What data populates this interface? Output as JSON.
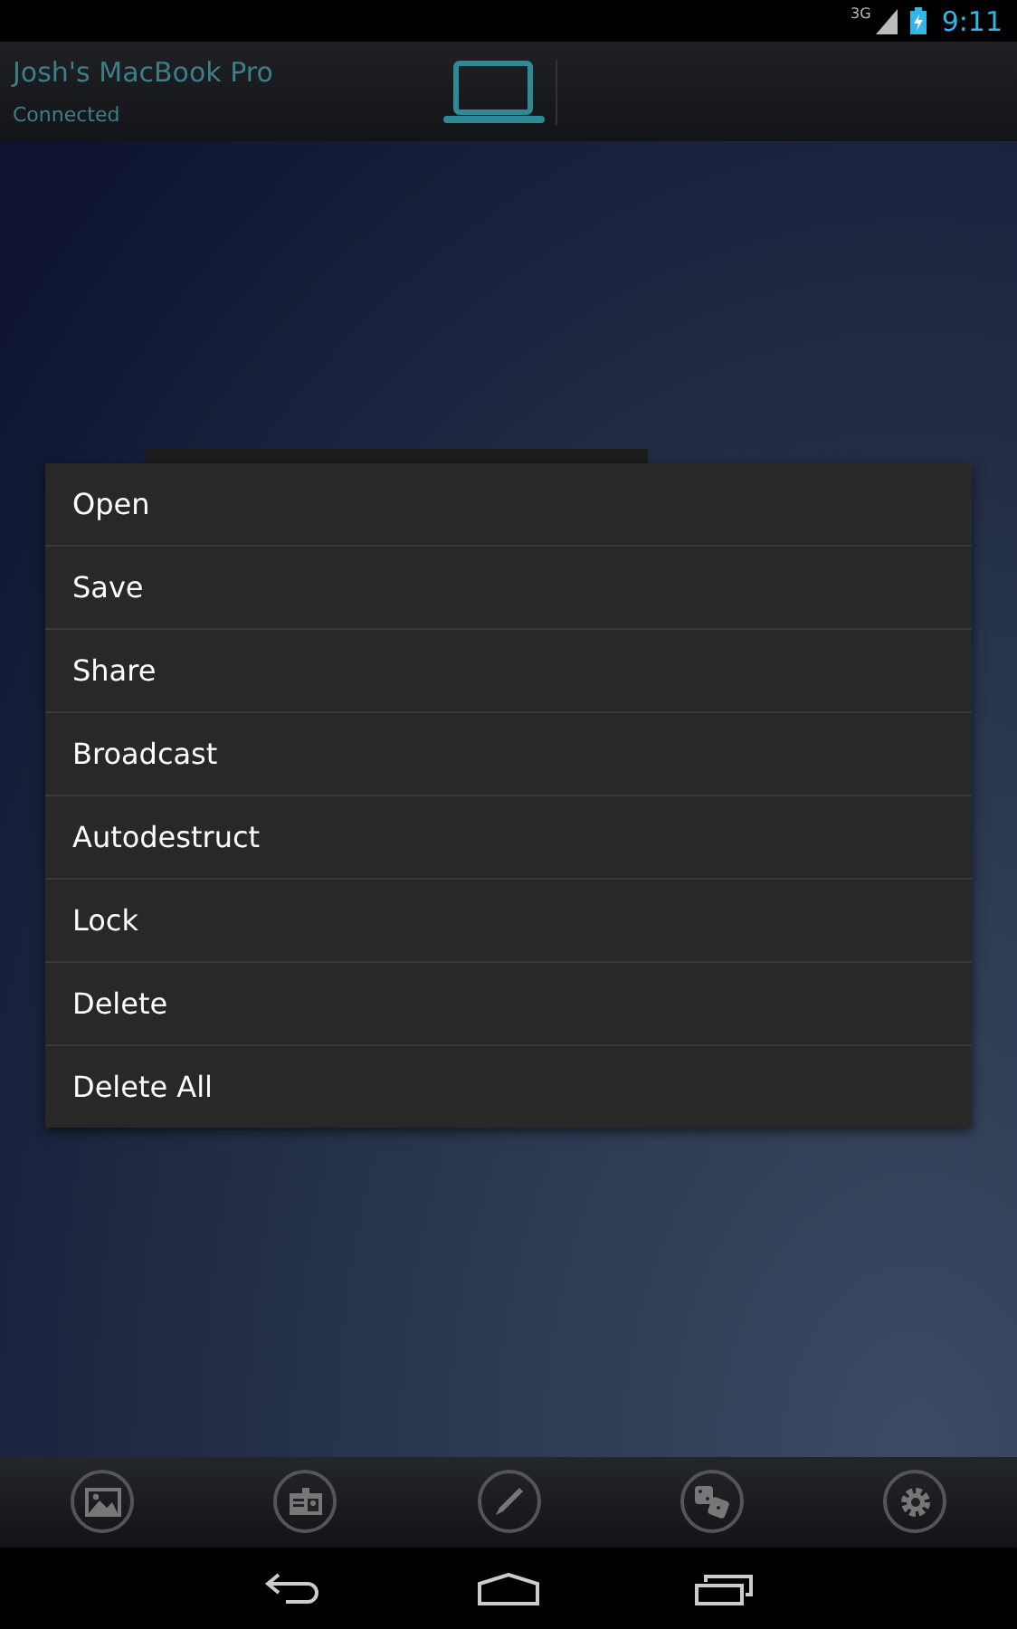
{
  "status_bar": {
    "network": "3G",
    "time": "9:11"
  },
  "header": {
    "device_name": "Josh's MacBook Pro",
    "status": "Connected"
  },
  "context_menu": {
    "items": [
      {
        "label": "Open"
      },
      {
        "label": "Save"
      },
      {
        "label": "Share"
      },
      {
        "label": "Broadcast"
      },
      {
        "label": "Autodestruct"
      },
      {
        "label": "Lock"
      },
      {
        "label": "Delete"
      },
      {
        "label": "Delete All"
      }
    ]
  }
}
